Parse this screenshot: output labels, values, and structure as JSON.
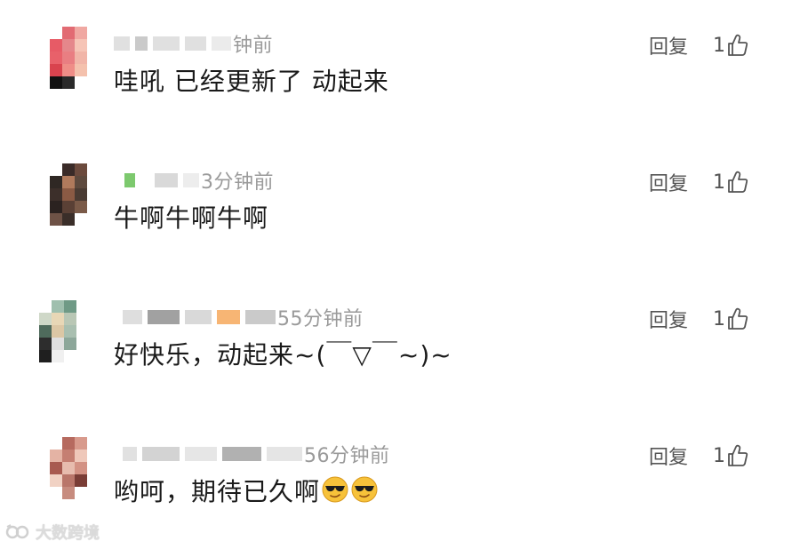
{
  "comments": [
    {
      "time": "钟前",
      "text": "哇吼  已经更新了   动起来",
      "reply_label": "回复",
      "like_count": "1",
      "avatar_colors": [
        "#ffffff",
        "#e26b73",
        "#f0a8a2",
        "#ffffff",
        "#e75b66",
        "#e5878b",
        "#f6c4b6",
        "#ffffff",
        "#e8616a",
        "#e97e82",
        "#f1b5a8",
        "#ffffff",
        "#d9434e",
        "#ef8d87",
        "#f4c1ad",
        "#ffffff",
        "#111111",
        "#2a2a2a",
        "#ffffff",
        "#ffffff"
      ]
    },
    {
      "time": "3分钟前",
      "text": "牛啊牛啊牛啊",
      "reply_label": "回复",
      "like_count": "1",
      "avatar_colors": [
        "#ffffff",
        "#3a2b28",
        "#6b4a3d",
        "#ffffff",
        "#2f2824",
        "#b07a5c",
        "#5e4a3e",
        "#ffffff",
        "#3c2f2a",
        "#8a5a44",
        "#4a3b33",
        "#ffffff",
        "#2b2220",
        "#5a4035",
        "#7a5a48",
        "#ffffff",
        "#6e5246",
        "#3a2e29",
        "#ffffff",
        "#ffffff"
      ]
    },
    {
      "time": "55分钟前",
      "text": "好快乐，动起来~(￣▽￣~)~",
      "reply_label": "回复",
      "like_count": "1",
      "avatar_colors": [
        "#ffffff",
        "#9fbfae",
        "#6f9a86",
        "#ffffff",
        "#cfd8c8",
        "#e8d7b6",
        "#b9c7b5",
        "#ffffff",
        "#4f6b5c",
        "#dcc7a5",
        "#a9bfb0",
        "#ffffff",
        "#2d2d2d",
        "#e0e0e0",
        "#8da79a",
        "#ffffff",
        "#1f1f1f",
        "#f0f0f0",
        "#ffffff",
        "#ffffff"
      ]
    },
    {
      "time": "56分钟前",
      "text": "哟呵，期待已久啊",
      "reply_label": "回复",
      "like_count": "1",
      "avatar_colors": [
        "#ffffff",
        "#b66a5f",
        "#d89a8c",
        "#ffffff",
        "#e4b3a4",
        "#c57f72",
        "#efc8ba",
        "#ffffff",
        "#a85a50",
        "#e7bcae",
        "#d39284",
        "#ffffff",
        "#f1d2c4",
        "#b9766a",
        "#7a3d36",
        "#ffffff",
        "#ffffff",
        "#c78c7f",
        "#ffffff",
        "#ffffff"
      ]
    }
  ],
  "watermark": "大数跨境",
  "colors": {
    "text": "#1a1a1a",
    "meta": "#9a9a9a",
    "action": "#555555",
    "background": "#ffffff"
  },
  "icons": {
    "like": "thumbs-up-icon",
    "emoji": "smiling-face-with-sunglasses-icon",
    "watermark_logo": "dashu-logo-icon"
  }
}
